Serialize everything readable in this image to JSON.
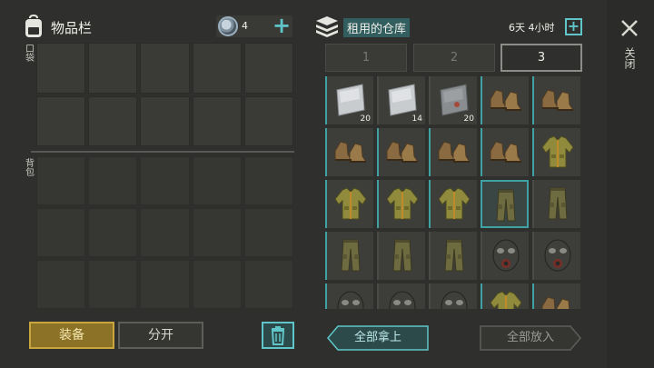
{
  "inventory": {
    "title": "物品栏",
    "coin_count": "4",
    "pocket_label": "口袋",
    "backpack_label": "背包",
    "equip_button": "装备",
    "split_button": "分开"
  },
  "storage": {
    "title": "租用的仓库",
    "timer": "6天 4小时",
    "tabs": [
      "1",
      "2",
      "3"
    ],
    "active_tab": "3",
    "close_label": "关闭",
    "take_all_button": "全部拿上",
    "put_all_button": "全部放入",
    "items": [
      {
        "type": "metal-sheet",
        "qty": "20"
      },
      {
        "type": "metal-sheet",
        "qty": "14"
      },
      {
        "type": "dark-metal-sheet",
        "qty": "20"
      },
      {
        "type": "boots",
        "qty": ""
      },
      {
        "type": "boots",
        "qty": ""
      },
      {
        "type": "boots",
        "qty": ""
      },
      {
        "type": "boots",
        "qty": ""
      },
      {
        "type": "boots",
        "qty": ""
      },
      {
        "type": "boots",
        "qty": ""
      },
      {
        "type": "jacket",
        "qty": ""
      },
      {
        "type": "jacket",
        "qty": ""
      },
      {
        "type": "jacket",
        "qty": ""
      },
      {
        "type": "jacket",
        "qty": ""
      },
      {
        "type": "pants",
        "qty": ""
      },
      {
        "type": "pants",
        "qty": ""
      },
      {
        "type": "pants",
        "qty": ""
      },
      {
        "type": "pants",
        "qty": ""
      },
      {
        "type": "pants",
        "qty": ""
      },
      {
        "type": "gas-mask",
        "qty": ""
      },
      {
        "type": "gas-mask",
        "qty": ""
      },
      {
        "type": "gas-mask",
        "qty": ""
      },
      {
        "type": "gas-mask",
        "qty": ""
      },
      {
        "type": "gas-mask",
        "qty": ""
      },
      {
        "type": "jacket",
        "qty": ""
      },
      {
        "type": "boots",
        "qty": ""
      }
    ]
  },
  "colors": {
    "accent": "#5fc5c8",
    "equip_gold": "#c9a53d"
  }
}
